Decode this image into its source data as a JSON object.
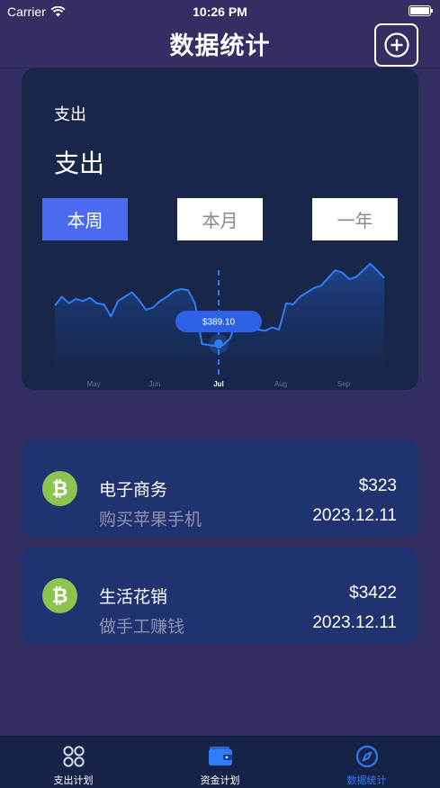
{
  "status_bar": {
    "carrier": "Carrier",
    "time": "10:26 PM",
    "icons": [
      "wifi-icon",
      "battery-icon"
    ]
  },
  "nav": {
    "title": "数据统计",
    "add_icon": "plus-circle-icon"
  },
  "chart_card": {
    "label_small": "支出",
    "label_large": "支出",
    "tabs": [
      {
        "label": "本周",
        "selected": true
      },
      {
        "label": "本月",
        "selected": false
      },
      {
        "label": "一年",
        "selected": false
      }
    ],
    "tooltip_value": "$389.10"
  },
  "chart_data": {
    "type": "area",
    "x_labels": [
      "May",
      "Jun",
      "Jul",
      "Aug",
      "Sep"
    ],
    "highlight_label": "Jul",
    "highlight_value": "$389.10",
    "values": [
      40,
      48,
      42,
      46,
      44,
      47,
      42,
      41,
      30,
      44,
      48,
      52,
      45,
      36,
      38,
      44,
      48,
      53,
      55,
      54,
      42,
      5,
      4,
      3,
      4,
      10,
      28,
      30,
      28,
      18,
      17,
      20,
      18,
      42,
      41,
      48,
      52,
      56,
      58,
      65,
      72,
      70,
      64,
      66,
      72,
      78,
      72,
      65
    ],
    "series": [
      {
        "values": [
          40,
          48,
          42,
          46,
          44,
          47,
          42,
          41,
          30,
          44,
          48,
          52,
          45,
          36,
          38,
          44,
          48,
          53,
          55,
          54,
          42,
          5,
          4,
          3,
          4,
          10,
          28,
          30,
          28,
          18,
          17,
          20,
          18,
          42,
          41,
          48,
          52,
          56,
          58,
          65,
          72,
          70,
          64,
          66,
          72,
          78,
          72,
          65
        ],
        "color": "#2f7df6"
      }
    ],
    "colors": {
      "line": "#2f7df6",
      "area": "#1f4a9a",
      "tooltip": "#2e62e6"
    }
  },
  "transactions": [
    {
      "category": "电子商务",
      "description": "购买苹果手机",
      "amount": "$323",
      "date": "2023.12.11",
      "icon": "bitcoin-icon"
    },
    {
      "category": "生活花销",
      "description": "做手工赚钱",
      "amount": "$3422",
      "date": "2023.12.11",
      "icon": "bitcoin-icon"
    }
  ],
  "tab_bar": {
    "items": [
      {
        "label": "支出计划",
        "icon": "four-circles-icon",
        "active": false
      },
      {
        "label": "资金计划",
        "icon": "wallet-icon",
        "active": false
      },
      {
        "label": "数据统计",
        "icon": "compass-icon",
        "active": true
      }
    ],
    "active_color": "#2f7df6"
  },
  "colors": {
    "background": "#342f63",
    "card": "#172649",
    "tx_card": "#1f3371",
    "accent": "#4a6af0",
    "icon_green": "#8dc351"
  }
}
